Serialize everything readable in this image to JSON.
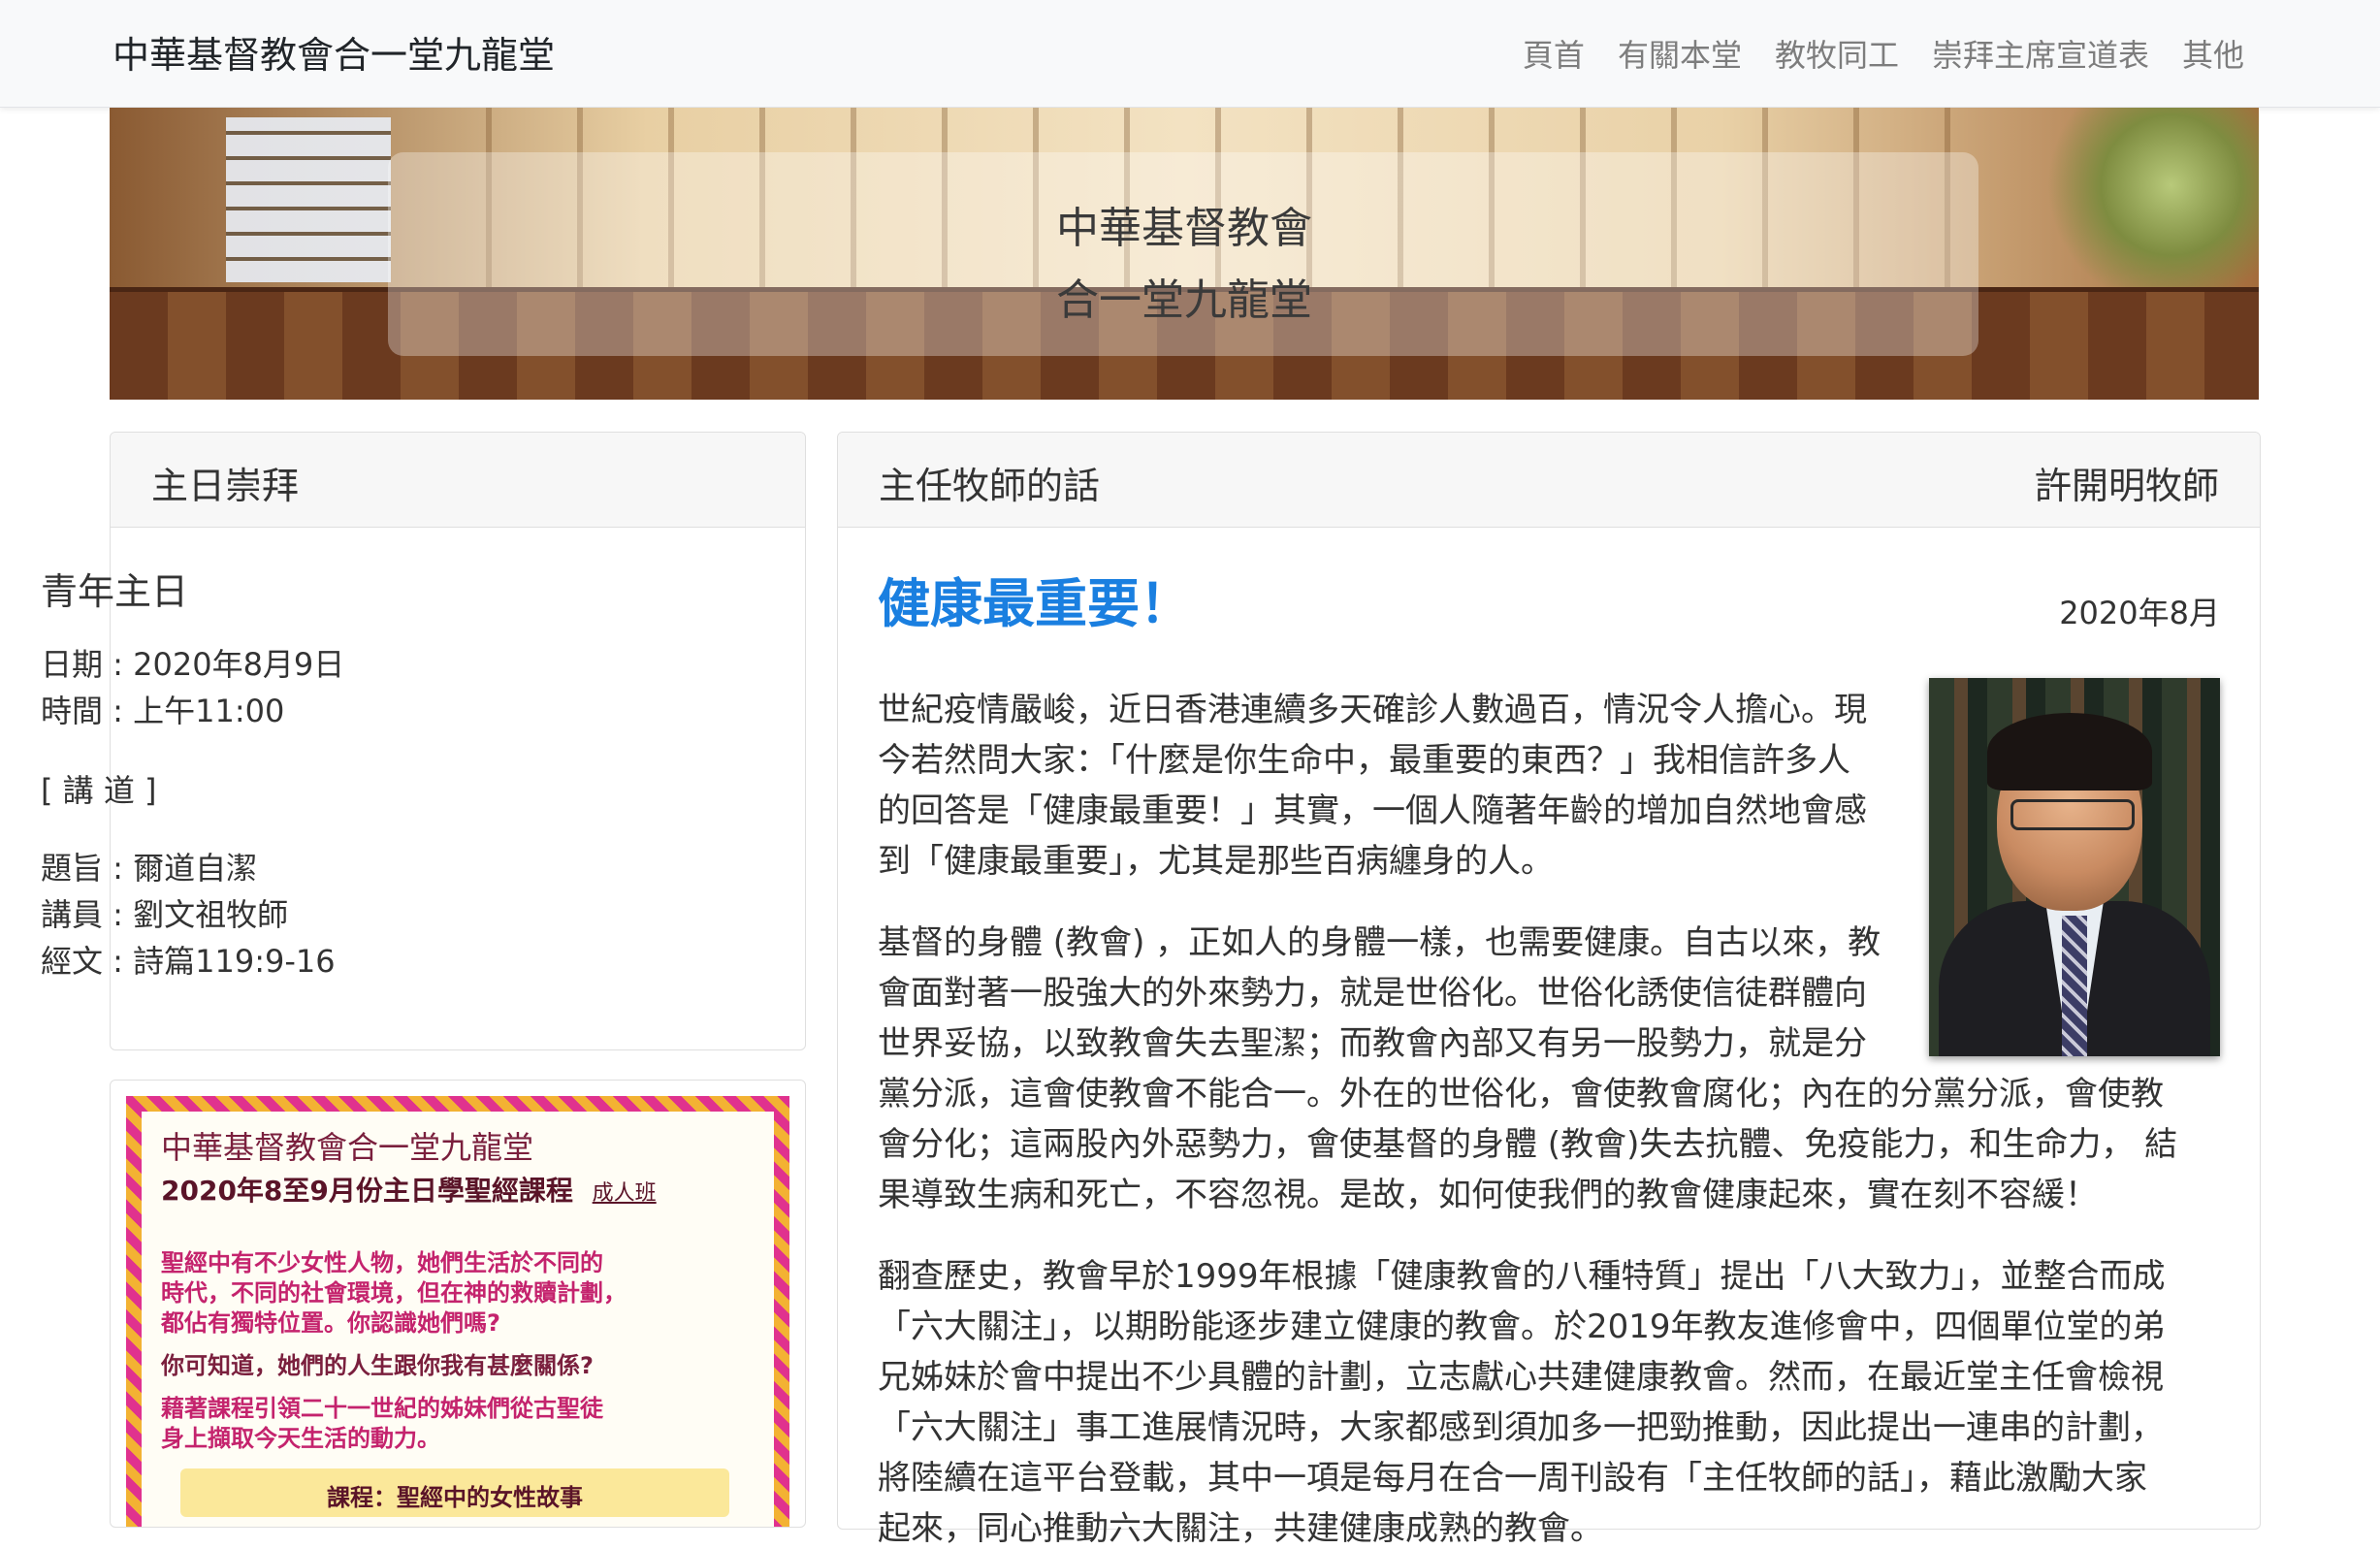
{
  "navbar": {
    "brand": "中華基督教會合一堂九龍堂",
    "items": [
      "頁首",
      "有關本堂",
      "教牧同工",
      "崇拜主席宣道表",
      "其他"
    ]
  },
  "hero": {
    "line1": "中華基督教會",
    "line2": "合一堂九龍堂"
  },
  "service": {
    "header": "主日崇拜",
    "title": "青年主日",
    "date": "日期 : 2020年8月9日",
    "time": "時間 : 上午11:00",
    "sermon_tag": "[ 講 道 ]",
    "topic": "題旨 :  爾道自潔",
    "speaker": "講員 :  劉文祖牧師",
    "scripture": "經文 :  詩篇119:9-16"
  },
  "poster": {
    "title": "中華基督教會合一堂九龍堂",
    "subtitle": "2020年8至9月份主日學聖經課程",
    "tag": "成人班",
    "text1": "聖經中有不少女性人物，她們生活於不同的",
    "text2": "時代，不同的社會環境，但在神的救贖計劃，",
    "text3": "都佔有獨特位置。你認識她們嗎?",
    "text4": "你可知道，她們的人生跟你我有甚麼關係?",
    "text5": "藉著課程引領二十一世紀的姊妹們從古聖徒",
    "text6": "身上擷取今天生活的動力。",
    "course": "課程：聖經中的女性故事"
  },
  "article": {
    "header_left": "主任牧師的話",
    "header_right": "許開明牧師",
    "title": "健康最重要！",
    "date": "2020年8月",
    "lines": [
      "世紀疫情嚴峻，近日香港連續多天確診人數過百，情況令人擔心。現",
      "今若然問大家：「什麼是你生命中，最重要的東西？」我相信許多人",
      "的回答是「健康最重要！」其實，一個人隨著年齡的增加自然地會感",
      "到「健康最重要」，尤其是那些百病纏身的人。",
      "基督的身體 (教會) ，正如人的身體一樣，也需要健康。自古以來，教",
      "會面對著一股強大的外來勢力，就是世俗化。世俗化誘使信徒群體向",
      "世界妥協，以致教會失去聖潔；而教會內部又有另一股勢力，就是分",
      "黨分派，這會使教會不能合一。外在的世俗化，會使教會腐化；內在的分黨分派，會使教",
      "會分化；這兩股內外惡勢力，會使基督的身體 (教會)失去抗體、免疫能力，和生命力， 結",
      "果導致生病和死亡，不容忽視。是故，如何使我們的教會健康起來，實在刻不容緩！",
      "翻查歷史，教會早於1999年根據「健康教會的八種特質」提出「八大致力」，並整合而成",
      "「六大關注」，以期盼能逐步建立健康的教會。於2019年教友進修會中，四個單位堂的弟",
      "兄姊妹於會中提出不少具體的計劃，立志獻心共建健康教會。然而，在最近堂主任會檢視",
      "「六大關注」事工進展情況時，大家都感到須加多一把勁推動，因此提出一連串的計劃，",
      "將陸續在這平台登載，其中一項是每月在合一周刊設有「主任牧師的話」，藉此激勵大家",
      "起來，同心推動六大關注，共建健康成熟的教會。"
    ]
  }
}
